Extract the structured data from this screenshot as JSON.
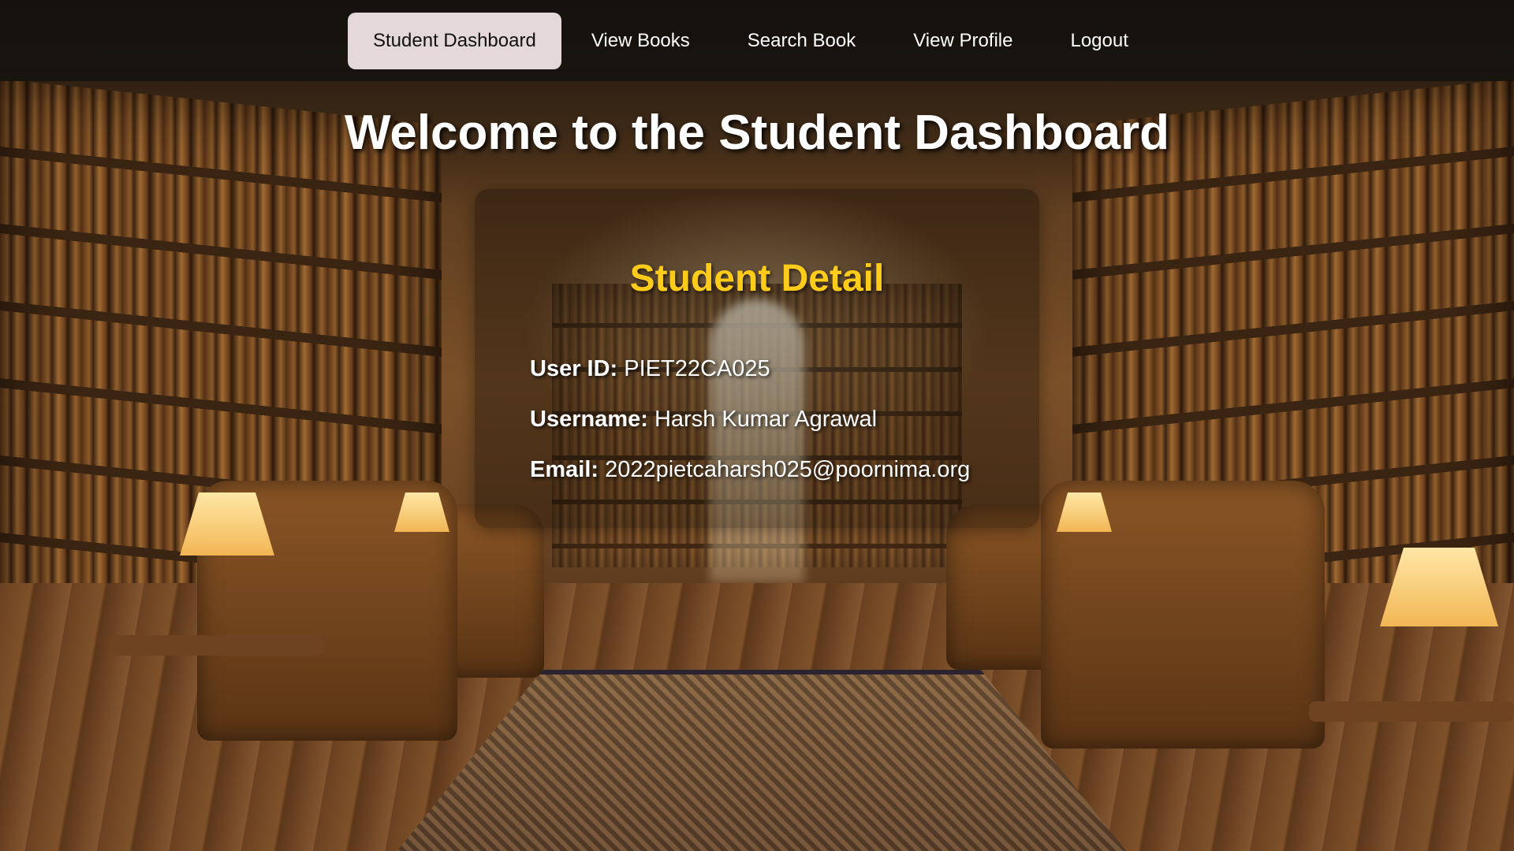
{
  "nav": {
    "items": [
      {
        "label": "Student Dashboard",
        "active": true
      },
      {
        "label": "View Books",
        "active": false
      },
      {
        "label": "Search Book",
        "active": false
      },
      {
        "label": "View Profile",
        "active": false
      },
      {
        "label": "Logout",
        "active": false
      }
    ]
  },
  "page": {
    "title": "Welcome to the Student Dashboard"
  },
  "student_card": {
    "title": "Student Detail",
    "fields": [
      {
        "label": "User ID:",
        "value": "PIET22CA025"
      },
      {
        "label": "Username:",
        "value": "Harsh Kumar Agrawal"
      },
      {
        "label": "Email:",
        "value": "2022pietcaharsh025@poornima.org"
      }
    ]
  },
  "colors": {
    "nav_background": "#14110e",
    "nav_active_background": "#e5d8da",
    "card_title": "#ffcc1a",
    "text": "#ffffff"
  }
}
